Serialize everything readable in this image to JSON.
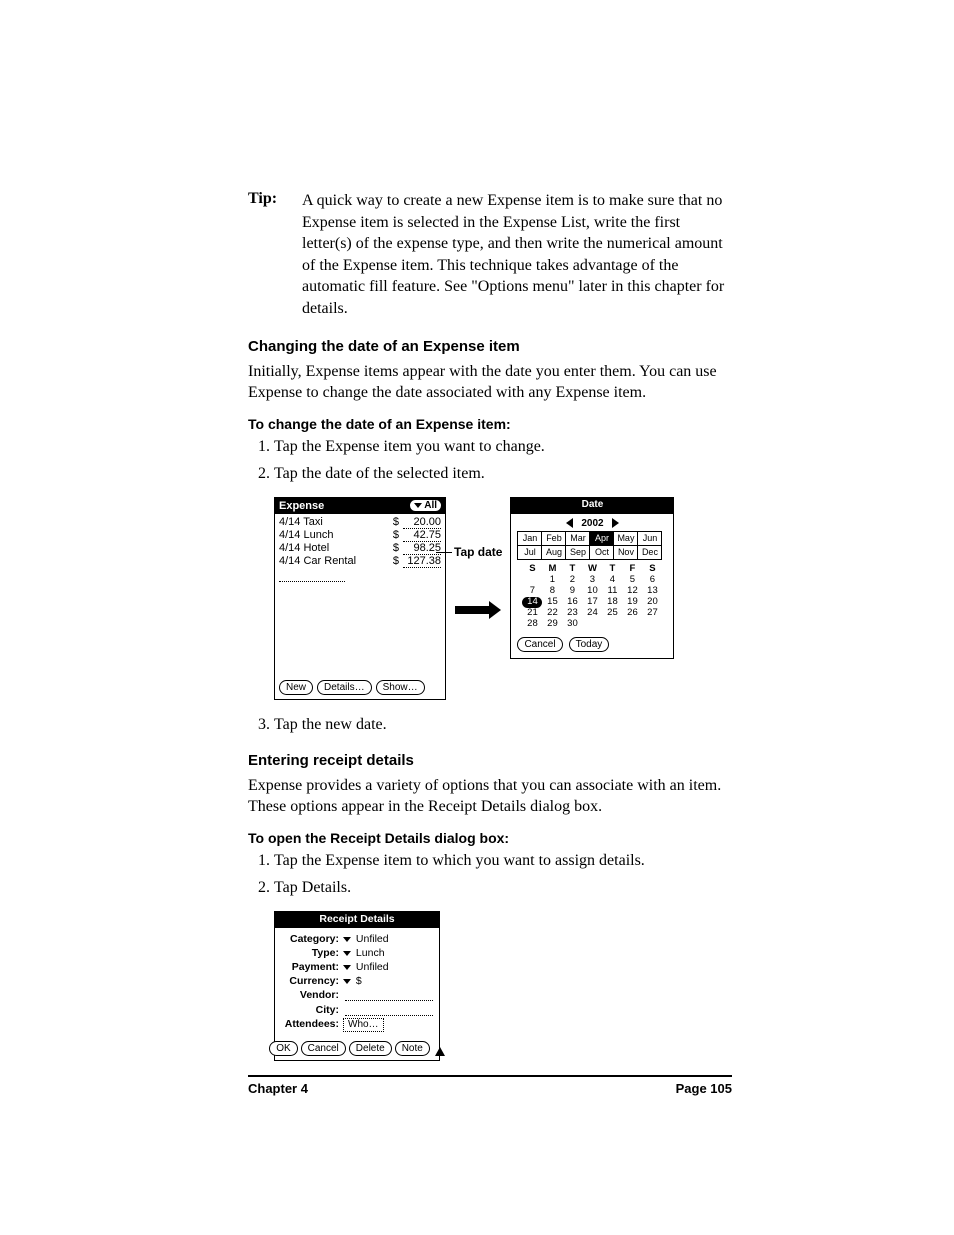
{
  "tip": {
    "label": "Tip:",
    "body": "A quick way to create a new Expense item is to make sure that no Expense item is selected in the Expense List, write the first letter(s) of the expense type, and then write the numerical amount of the Expense item. This technique takes advantage of the automatic fill feature. See \"Options menu\" later in this chapter for details."
  },
  "section1": {
    "heading": "Changing the date of an Expense item",
    "intro": "Initially, Expense items appear with the date you enter them. You can use Expense to change the date associated with any Expense item.",
    "proc_heading": "To change the date of an Expense item:",
    "steps": [
      "Tap the Expense item you want to change.",
      "Tap the date of the selected item."
    ],
    "step_after_figure": "Tap the new date."
  },
  "expense_panel": {
    "title": "Expense",
    "all_label": "All",
    "currency": "$",
    "items": [
      {
        "date_label": "4/14 Taxi",
        "amount": "20.00"
      },
      {
        "date_label": "4/14 Lunch",
        "amount": "42.75"
      },
      {
        "date_label": "4/14 Hotel",
        "amount": "98.25"
      },
      {
        "date_label": "4/14 Car Rental",
        "amount": "127.38"
      }
    ],
    "buttons": {
      "new": "New",
      "details": "Details…",
      "show": "Show…"
    }
  },
  "mid_label": "Tap date",
  "date_panel": {
    "title": "Date",
    "year": "2002",
    "months_row1": [
      "Jan",
      "Feb",
      "Mar",
      "Apr",
      "May",
      "Jun"
    ],
    "months_row2": [
      "Jul",
      "Aug",
      "Sep",
      "Oct",
      "Nov",
      "Dec"
    ],
    "selected_month": "Apr",
    "dow": [
      "S",
      "M",
      "T",
      "W",
      "T",
      "F",
      "S"
    ],
    "weeks": [
      [
        "",
        "1",
        "2",
        "3",
        "4",
        "5",
        "6"
      ],
      [
        "7",
        "8",
        "9",
        "10",
        "11",
        "12",
        "13"
      ],
      [
        "14",
        "15",
        "16",
        "17",
        "18",
        "19",
        "20"
      ],
      [
        "21",
        "22",
        "23",
        "24",
        "25",
        "26",
        "27"
      ],
      [
        "28",
        "29",
        "30",
        "",
        "",
        "",
        ""
      ]
    ],
    "selected_day": "14",
    "buttons": {
      "cancel": "Cancel",
      "today": "Today"
    }
  },
  "section2": {
    "heading": "Entering receipt details",
    "intro": "Expense provides a variety of options that you can associate with an item. These options appear in the Receipt Details dialog box.",
    "proc_heading": "To open the Receipt Details dialog box:",
    "steps": [
      "Tap the Expense item to which you want to assign details.",
      "Tap Details."
    ]
  },
  "receipt": {
    "title": "Receipt Details",
    "rows": {
      "category": {
        "label": "Category:",
        "value": "Unfiled"
      },
      "type": {
        "label": "Type:",
        "value": "Lunch"
      },
      "payment": {
        "label": "Payment:",
        "value": "Unfiled"
      },
      "currency": {
        "label": "Currency:",
        "value": "$"
      },
      "vendor": {
        "label": "Vendor:"
      },
      "city": {
        "label": "City:"
      },
      "attendees": {
        "label": "Attendees:",
        "button": "Who…"
      }
    },
    "buttons": {
      "ok": "OK",
      "cancel": "Cancel",
      "delete": "Delete",
      "note": "Note"
    }
  },
  "footer": {
    "chapter": "Chapter 4",
    "page": "Page 105"
  }
}
